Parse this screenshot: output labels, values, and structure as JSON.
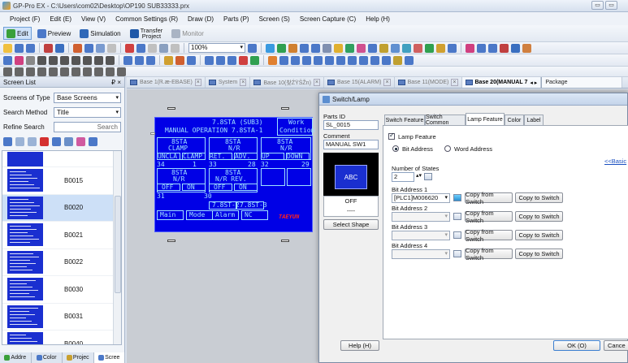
{
  "window": {
    "title": "GP-Pro EX - C:\\Users\\com02\\Desktop\\OP190 SUB33333.prx"
  },
  "menu": [
    "Project (F)",
    "Edit (E)",
    "View (V)",
    "Common Settings (R)",
    "Draw (D)",
    "Parts (P)",
    "Screen (S)",
    "Screen Capture (C)",
    "Help (H)"
  ],
  "toolbar1": {
    "edit": "Edit",
    "preview": "Preview",
    "simulation": "Simulation",
    "transfer_line1": "Transfer",
    "transfer_line2": "Project",
    "monitor": "Monitor"
  },
  "toolbar2": {
    "zoom": "100%"
  },
  "left": {
    "header": "Screen List",
    "pin": "₽ ×",
    "type_label": "Screens of Type",
    "type_value": "Base Screens",
    "method_label": "Search Method",
    "method_value": "Title",
    "refine_label": "Refine Search",
    "search_button": "Search",
    "screens": [
      "B0015",
      "B0020",
      "B0021",
      "B0022",
      "B0030",
      "B0031",
      "B0040"
    ],
    "bottom_tabs": [
      "Addre",
      "Color",
      "Projec",
      "Scree"
    ]
  },
  "tabs": [
    {
      "label": "Base 1(Ꮢ.æ-EBASE)"
    },
    {
      "label": "System"
    },
    {
      "label": "Base 10(찾ŹŸŠŽn)"
    },
    {
      "label": "Base 15(ALARM)"
    },
    {
      "label": "Base 11(MODE)"
    },
    {
      "label": "Base 20(MANUAL 7"
    },
    {
      "label": "Package"
    }
  ],
  "lcd": {
    "title": "7.8STA (SUB3)",
    "subtitle": "MANUAL OPERATION 7.8STA-1",
    "work": "Work",
    "condition": "Condition",
    "b1a": "8STA",
    "b1b": "CLAMP",
    "b2a": "8STA",
    "b2b": "N/R",
    "b3a": "8STA",
    "b3b": "N/R",
    "r1": [
      "UNCLA",
      "CLAMP",
      "RET.",
      "ADV.",
      "UP",
      "DOWN"
    ],
    "n1": [
      "34",
      "1",
      "33",
      "28",
      "32",
      "29"
    ],
    "b4a": "8STA",
    "b4b": "N/R",
    "b5a": "8STA",
    "b5b": "N/R REV.",
    "r2": [
      "OFF",
      "ON",
      "OFF",
      "ON"
    ],
    "n2": [
      "31",
      "30"
    ],
    "sel1": "7.8ST-2",
    "sel2": "7.8ST-3",
    "bot": [
      "Main",
      "Mode",
      "Alarm",
      "NC"
    ],
    "logo": "TAEYUN"
  },
  "dialog": {
    "title": "Switch/Lamp",
    "parts_id_label": "Parts ID",
    "parts_id": "SL_0015",
    "comment_label": "Comment",
    "comment": "MANUAL SW1",
    "preview_text": "ABC",
    "state_off": "OFF",
    "state_dash": "----",
    "select_shape": "Select Shape",
    "tabs": [
      "Switch Feature",
      "Switch Common",
      "Lamp Feature",
      "Color",
      "Label"
    ],
    "lamp_feature": "Lamp Feature",
    "bit_address": "Bit Address",
    "word_address": "Word Address",
    "basic": "<<Basic",
    "num_states_label": "Number of States",
    "num_states": "2",
    "addr1_label": "Bit Address 1",
    "addr1": "[PLC1]M006620",
    "addr2_label": "Bit Address 2",
    "addr3_label": "Bit Address 3",
    "addr4_label": "Bit Address 4",
    "copy_from": "Copy from Switch",
    "copy_to": "Copy to Switch",
    "help": "Help (H)",
    "ok": "OK (O)",
    "cancel": "Cance"
  }
}
